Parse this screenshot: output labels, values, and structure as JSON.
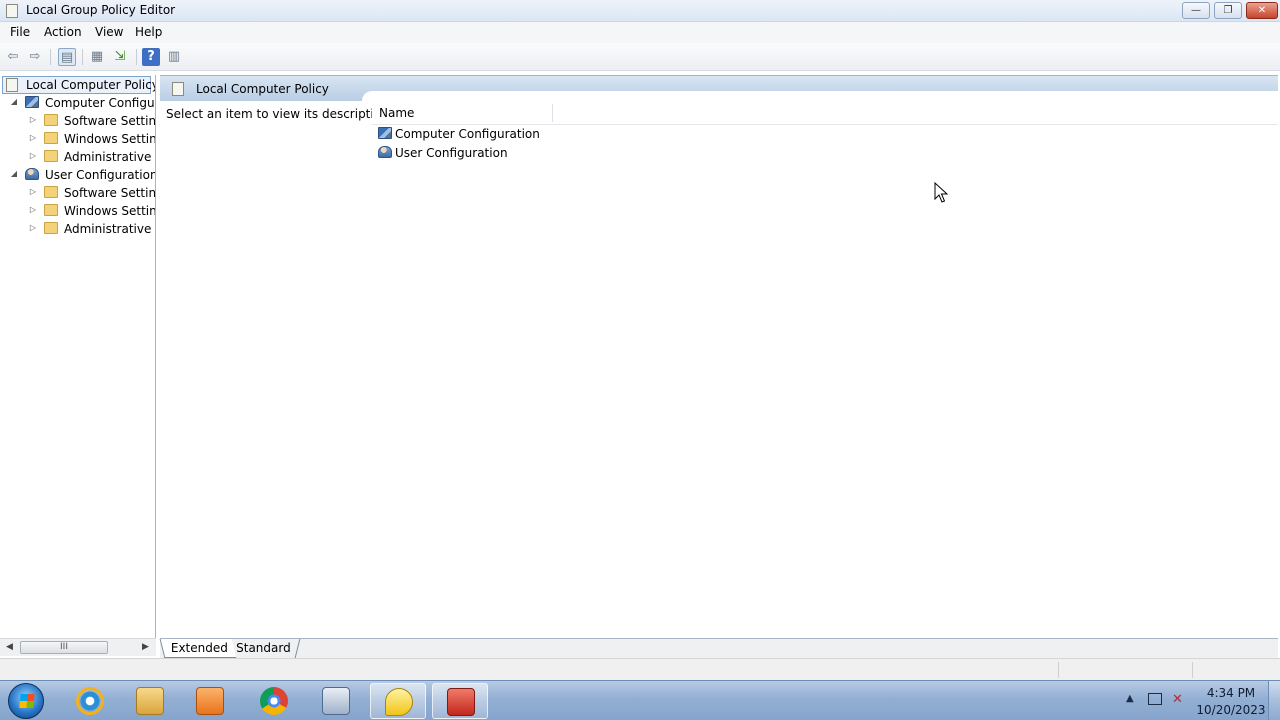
{
  "window": {
    "title": "Local Group Policy Editor",
    "controls": {
      "minimize": "—",
      "maximize": "❐",
      "close": "✕"
    }
  },
  "menu": [
    "File",
    "Action",
    "View",
    "Help"
  ],
  "toolbar": {
    "icons": [
      "back-arrow-icon",
      "forward-arrow-icon",
      "show-hide-tree-icon",
      "properties-icon",
      "export-list-icon",
      "help-icon",
      "action-pane-icon"
    ],
    "glyphs": {
      "back": "⇦",
      "forward": "⇨",
      "tree": "▤",
      "props": "▦",
      "export": "⇲",
      "help": "?",
      "pane": "▥"
    }
  },
  "tree": {
    "root": "Local Computer Policy",
    "items": [
      {
        "label": "Computer Configura",
        "expanded": true,
        "icon": "computer-icon"
      },
      {
        "label": "Software Settings",
        "icon": "folder-icon"
      },
      {
        "label": "Windows Setting",
        "icon": "folder-icon"
      },
      {
        "label": "Administrative Te",
        "icon": "folder-icon"
      },
      {
        "label": "User Configuration",
        "expanded": true,
        "icon": "user-icon"
      },
      {
        "label": "Software Settings",
        "icon": "folder-icon"
      },
      {
        "label": "Windows Setting",
        "icon": "folder-icon"
      },
      {
        "label": "Administrative Te",
        "icon": "folder-icon"
      }
    ],
    "arrows": {
      "expanded": "◢",
      "collapsed": "▷"
    }
  },
  "pane": {
    "header": "Local Computer Policy",
    "description": "Select an item to view its description.",
    "column": "Name",
    "rows": [
      "Computer Configuration",
      "User Configuration"
    ]
  },
  "scroll": {
    "left": "◀",
    "right": "▶",
    "thumb": "III"
  },
  "tabs": [
    "Extended",
    "Standard"
  ],
  "taskbar": {
    "apps": [
      "internet-explorer",
      "file-explorer",
      "media-player",
      "chrome",
      "on-screen-keyboard",
      "messenger",
      "toolbox"
    ],
    "active": "toolbox",
    "tray": {
      "chevron": "▲",
      "volume": "✕",
      "time": "4:34 PM",
      "date": "10/20/2023"
    }
  },
  "colors": {
    "pane_header": "#b9cde4",
    "selection_border": "#7da2ce",
    "taskbar": "#93afd3"
  }
}
